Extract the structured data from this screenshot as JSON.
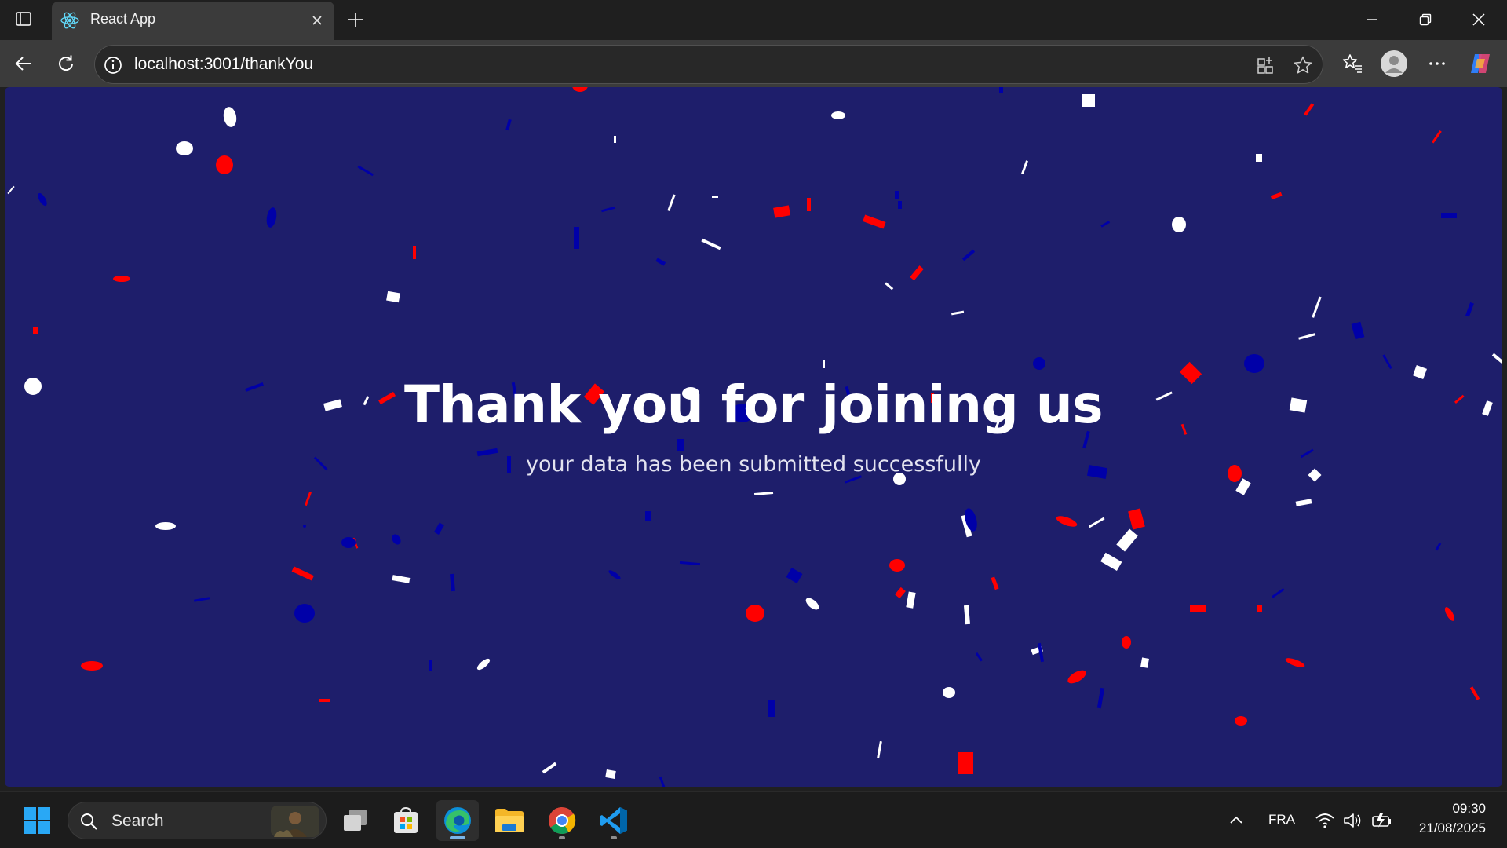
{
  "browser": {
    "tab": {
      "title": "React App",
      "favicon": "react-icon"
    },
    "address_bar": {
      "url": "localhost:3001/thankYou"
    },
    "icons": [
      "tab-actions-icon",
      "close-icon",
      "plus-icon",
      "back-arrow-icon",
      "refresh-icon",
      "info-icon",
      "app-available-icon",
      "star-icon",
      "favorites-icon",
      "profile-icon",
      "more-icon",
      "copilot-icon",
      "minimize-icon",
      "restore-icon"
    ]
  },
  "page": {
    "heading": "Thank you for joining us",
    "subheading": "your data has been submitted successfully",
    "colors": {
      "background": "#1e1e6b",
      "confetti": [
        "#ff0000",
        "#ffffff",
        "#0000a8"
      ]
    }
  },
  "taskbar": {
    "search_label": "Search",
    "apps": [
      "windows-start-icon",
      "task-view-icon",
      "microsoft-store-icon",
      "edge-icon",
      "file-explorer-icon",
      "chrome-icon",
      "vscode-icon"
    ],
    "tray": {
      "language": "FRA",
      "time": "09:30",
      "date": "21/08/2025"
    }
  }
}
